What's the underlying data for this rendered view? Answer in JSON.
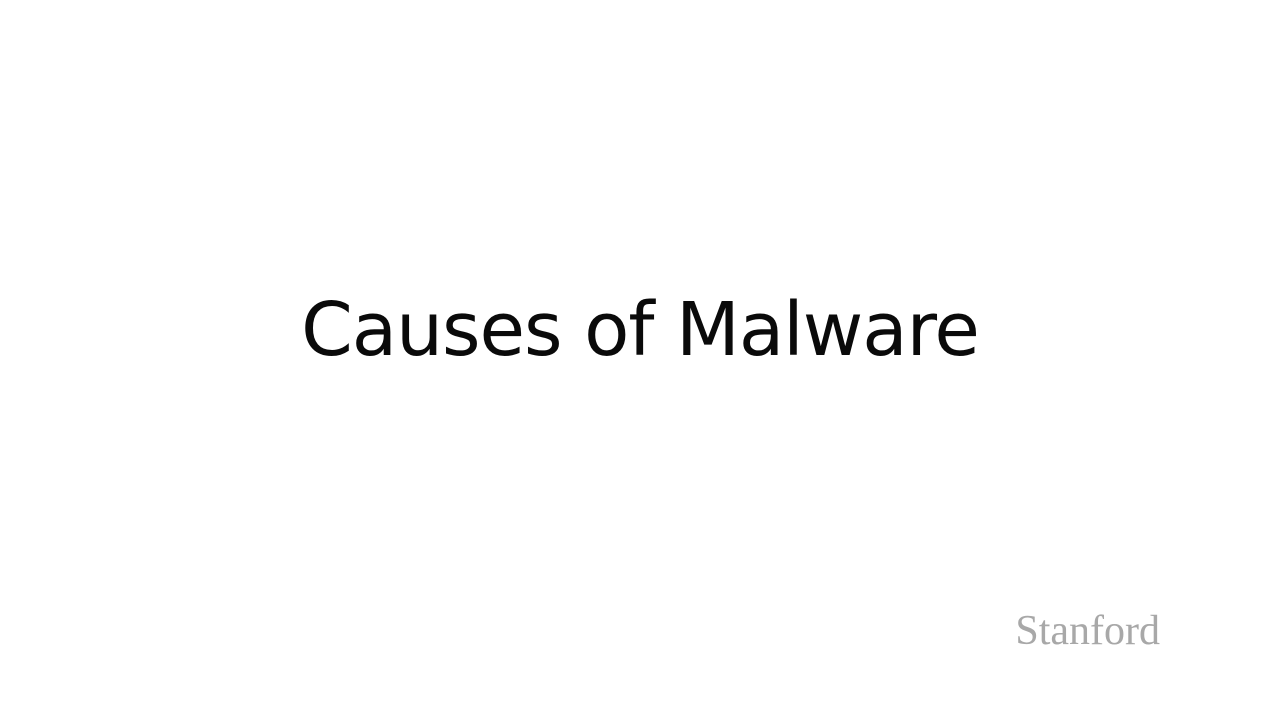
{
  "slide": {
    "title": "Causes of Malware",
    "logo_text": "Stanford"
  },
  "colors": {
    "background": "#ffffff",
    "title_text": "#0a0a0a",
    "logo_text": "#a8a8a8"
  }
}
